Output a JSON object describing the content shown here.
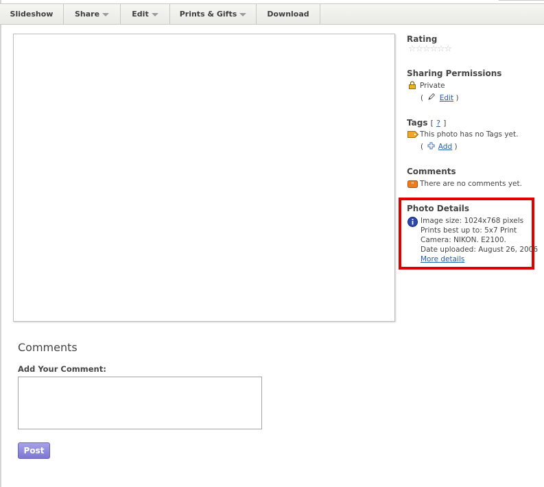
{
  "toolbar": {
    "slideshow": "Slideshow",
    "share": "Share",
    "edit": "Edit",
    "prints_gifts": "Prints & Gifts",
    "download": "Download"
  },
  "rating": {
    "title": "Rating",
    "stars": 0,
    "max_stars": 6
  },
  "sharing": {
    "title": "Sharing Permissions",
    "status": "Private",
    "open_paren": "(",
    "edit_link": "Edit",
    "close_paren": ")"
  },
  "tags": {
    "title": "Tags",
    "help_open": "[",
    "help_link": "?",
    "help_close": "]",
    "none_text": "This photo has no Tags yet.",
    "add_open": "(",
    "add_link": "Add",
    "add_close": ")"
  },
  "comments_side": {
    "title": "Comments",
    "none_text": "There are no comments yet."
  },
  "photo_details": {
    "title": "Photo Details",
    "image_size": "Image size: 1024x768 pixels",
    "prints_best": "Prints best up to: 5x7 Print",
    "camera": "Camera: NIKON. E2100.",
    "date_uploaded": "Date uploaded: August 26, 2006",
    "more_details": "More details"
  },
  "comments_main": {
    "title": "Comments",
    "add_label": "Add Your Comment:",
    "textarea_value": "",
    "post_label": "Post"
  },
  "colors": {
    "highlight": "#e00000",
    "link": "#1f5ea8",
    "post_button": "#8d87dc"
  }
}
